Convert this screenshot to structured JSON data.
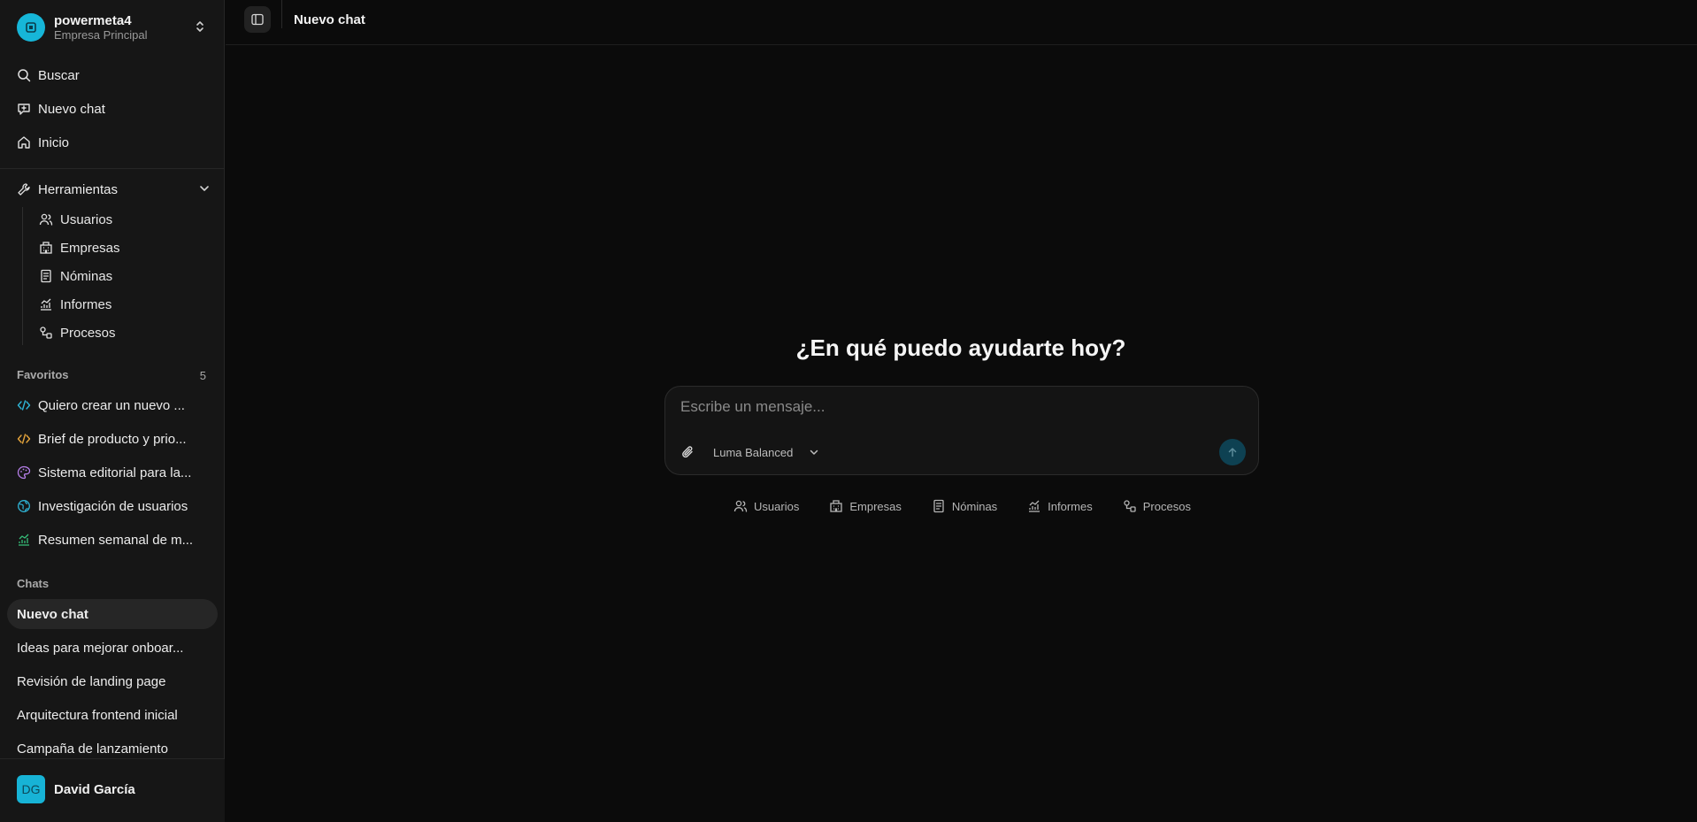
{
  "workspace": {
    "name": "powermeta4",
    "subtitle": "Empresa Principal",
    "logo_color": "#16b6d8"
  },
  "nav": [
    {
      "label": "Buscar",
      "icon": "search-icon"
    },
    {
      "label": "Nuevo chat",
      "icon": "new-chat-icon"
    },
    {
      "label": "Inicio",
      "icon": "home-icon"
    }
  ],
  "tools": {
    "label": "Herramientas",
    "items": [
      {
        "label": "Usuarios",
        "icon": "users-icon"
      },
      {
        "label": "Empresas",
        "icon": "building-icon"
      },
      {
        "label": "Nóminas",
        "icon": "document-icon"
      },
      {
        "label": "Informes",
        "icon": "chart-icon"
      },
      {
        "label": "Procesos",
        "icon": "workflow-icon"
      }
    ]
  },
  "favorites": {
    "label": "Favoritos",
    "count": "5",
    "items": [
      {
        "label": "Quiero crear un nuevo ...",
        "icon": "code-icon",
        "color": "#2fb4d6"
      },
      {
        "label": "Brief de producto y prio...",
        "icon": "code-icon",
        "color": "#e3a33b"
      },
      {
        "label": "Sistema editorial para la...",
        "icon": "palette-icon",
        "color": "#b57ee8"
      },
      {
        "label": "Investigación de usuarios",
        "icon": "globe-icon",
        "color": "#2fb4d6"
      },
      {
        "label": "Resumen semanal de m...",
        "icon": "chart-icon",
        "color": "#36c07a"
      }
    ]
  },
  "chats": {
    "label": "Chats",
    "items": [
      {
        "label": "Nuevo chat"
      },
      {
        "label": "Ideas para mejorar onboar..."
      },
      {
        "label": "Revisión de landing page"
      },
      {
        "label": "Arquitectura frontend inicial"
      },
      {
        "label": "Campaña de lanzamiento"
      }
    ]
  },
  "user": {
    "initials": "DG",
    "name": "David García",
    "avatar_color": "#17b3d6"
  },
  "header": {
    "title": "Nuevo chat"
  },
  "main": {
    "greeting": "¿En qué puedo ayudarte hoy?",
    "composer": {
      "placeholder": "Escribe un mensaje...",
      "model": "Luma Balanced"
    },
    "shortcuts": [
      {
        "label": "Usuarios",
        "icon": "users-icon"
      },
      {
        "label": "Empresas",
        "icon": "building-icon"
      },
      {
        "label": "Nóminas",
        "icon": "document-icon"
      },
      {
        "label": "Informes",
        "icon": "chart-icon"
      },
      {
        "label": "Procesos",
        "icon": "workflow-icon"
      }
    ]
  }
}
